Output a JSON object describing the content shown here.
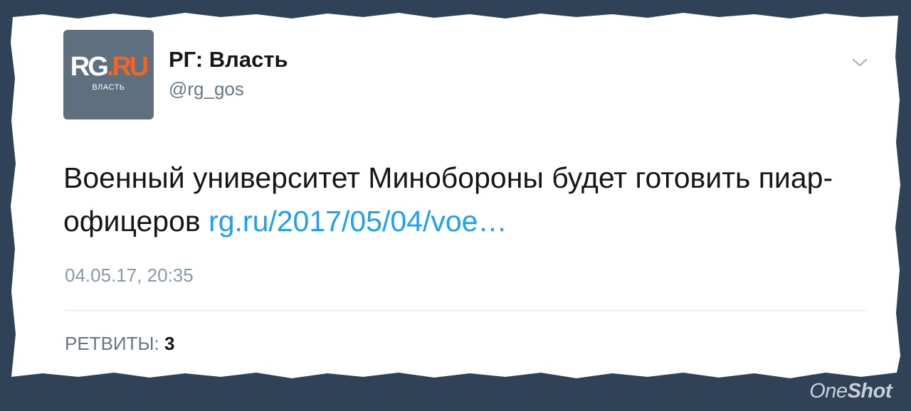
{
  "colors": {
    "background": "#2f4257",
    "card": "#ffffff",
    "link": "#1da1f2",
    "muted": "#657786",
    "avatar_bg": "#5e6f80",
    "logo_accent": "#f26522"
  },
  "tweet": {
    "author": {
      "avatar_logo_main": "RG",
      "avatar_logo_accent": ".RU",
      "avatar_logo_sub": "ВЛАСТЬ",
      "display_name": "РГ: Власть",
      "handle": "@rg_gos"
    },
    "menu_icon": "chevron-down-icon",
    "text": "Военный университет Минобороны будет готовить пиар-офицеров",
    "link_text": "rg.ru/2017/05/04/voe…",
    "timestamp": "04.05.17, 20:35",
    "retweets_label": "РЕТВИТЫ:",
    "retweets_count": "3"
  },
  "watermark": {
    "part1": "One",
    "part2": "Shot"
  }
}
